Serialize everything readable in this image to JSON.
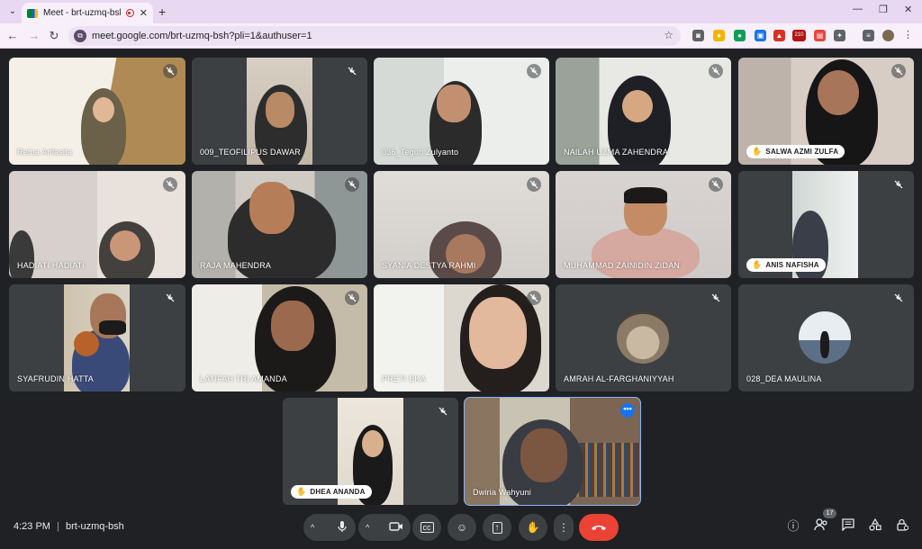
{
  "browser": {
    "tab_title": "Meet - brt-uzmq-bsh",
    "url": "meet.google.com/brt-uzmq-bsh?pli=1&authuser=1",
    "ext_badge": "210"
  },
  "participants": [
    {
      "name": "Retna Arilasita"
    },
    {
      "name": "009_TEOFILIPUS DAWAR"
    },
    {
      "name": "036_Teguh Zulyanto"
    },
    {
      "name": "NAILAH UZMA ZAHENDRA"
    },
    {
      "name": "SALWA AZMI ZULFA"
    },
    {
      "name": "HADIATI HADIATI"
    },
    {
      "name": "RAJA MAHENDRA"
    },
    {
      "name": "SYANIA DESTYA RAHMI"
    },
    {
      "name": "MUHAMMAD ZAINIDIN ZIDAN"
    },
    {
      "name": "ANIS NAFISHA"
    },
    {
      "name": "SYAFRUDIN HATTA"
    },
    {
      "name": "LATIFAH TRI AMANDA"
    },
    {
      "name": "PRETI EKA"
    },
    {
      "name": "AMRAH AL-FARGHANIYYAH"
    },
    {
      "name": "028_DEA MAULINA"
    },
    {
      "name": "DHEA ANANDA"
    },
    {
      "name": "Dwiria Wahyuni"
    }
  ],
  "meeting": {
    "time": "4:23 PM",
    "separator": "|",
    "code": "brt-uzmq-bsh",
    "people_count": "17"
  }
}
